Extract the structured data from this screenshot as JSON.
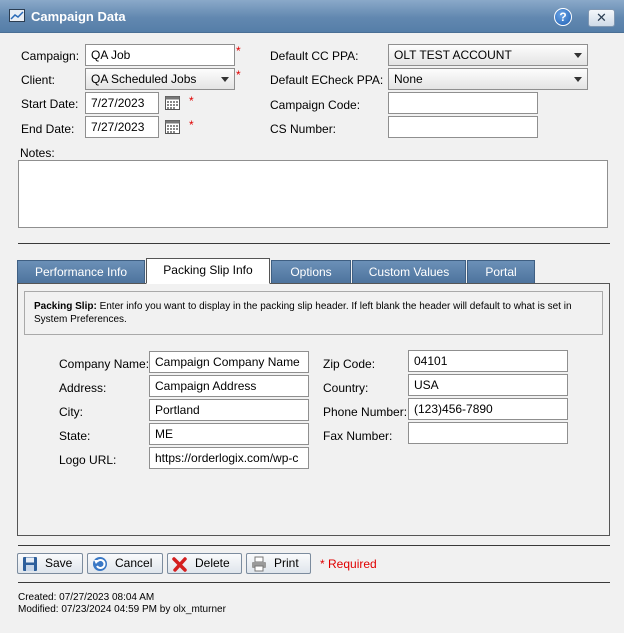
{
  "window": {
    "title": "Campaign Data",
    "help_icon": "help-icon",
    "close_icon": "close-icon"
  },
  "form": {
    "campaign_label": "Campaign:",
    "campaign_value": "QA Job",
    "client_label": "Client:",
    "client_value": "QA Scheduled Jobs",
    "start_date_label": "Start Date:",
    "start_date_value": "7/27/2023",
    "end_date_label": "End Date:",
    "end_date_value": "7/27/2023",
    "default_cc_ppa_label": "Default CC PPA:",
    "default_cc_ppa_value": "OLT TEST ACCOUNT",
    "default_echeck_ppa_label": "Default ECheck PPA:",
    "default_echeck_ppa_value": "None",
    "campaign_code_label": "Campaign Code:",
    "campaign_code_value": "",
    "cs_number_label": "CS Number:",
    "cs_number_value": "",
    "notes_label": "Notes:",
    "notes_value": "",
    "required_marker": "*"
  },
  "tabs": [
    {
      "label": "Performance Info",
      "active": false
    },
    {
      "label": "Packing Slip Info",
      "active": true
    },
    {
      "label": "Options",
      "active": false
    },
    {
      "label": "Custom Values",
      "active": false
    },
    {
      "label": "Portal",
      "active": false
    }
  ],
  "packing_slip": {
    "info_bold": "Packing Slip:",
    "info_text": " Enter info you want to display in the packing slip header. If left blank the header will default to what is set in System Preferences.",
    "company_name_label": "Company Name:",
    "company_name_value": "Campaign Company Name",
    "address_label": "Address:",
    "address_value": "Campaign Address",
    "city_label": "City:",
    "city_value": "Portland",
    "state_label": "State:",
    "state_value": "ME",
    "logo_url_label": "Logo URL:",
    "logo_url_value": "https://orderlogix.com/wp-c",
    "zip_code_label": "Zip Code:",
    "zip_code_value": "04101",
    "country_label": "Country:",
    "country_value": "USA",
    "phone_number_label": "Phone Number:",
    "phone_number_value": "(123)456-7890",
    "fax_number_label": "Fax Number:",
    "fax_number_value": ""
  },
  "buttons": {
    "save": "Save",
    "cancel": "Cancel",
    "delete": "Delete",
    "print": "Print",
    "required_note": "* Required"
  },
  "footer": {
    "created": "Created:  07/27/2023 08:04 AM",
    "modified": "Modified:  07/23/2024 04:59 PM by olx_mturner"
  },
  "colors": {
    "title_bar": "#6288b0",
    "tab_inactive": "#5a80a9",
    "required": "#e00000"
  }
}
